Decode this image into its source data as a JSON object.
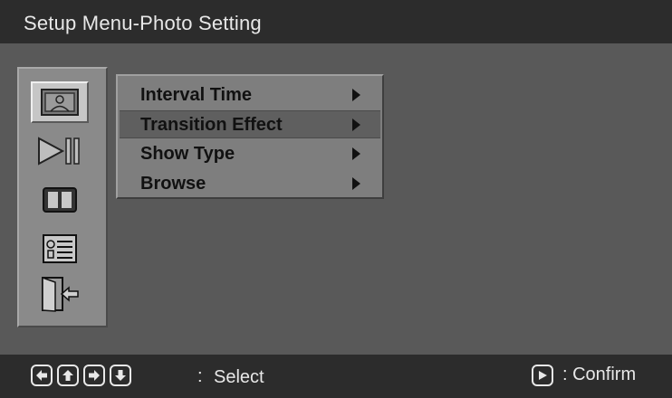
{
  "window": {
    "title": "Setup Menu-Photo Setting"
  },
  "sidebar": {
    "icons": [
      {
        "name": "photo-icon",
        "selected": true
      },
      {
        "name": "play-pause-icon",
        "selected": false
      },
      {
        "name": "display-icon",
        "selected": false
      },
      {
        "name": "info-card-icon",
        "selected": false
      },
      {
        "name": "exit-door-icon",
        "selected": false
      }
    ]
  },
  "menu": {
    "items": [
      {
        "label": "Interval Time",
        "highlighted": false
      },
      {
        "label": "Transition Effect",
        "highlighted": true
      },
      {
        "label": "Show Type",
        "highlighted": false
      },
      {
        "label": "Browse",
        "highlighted": false
      }
    ]
  },
  "footer": {
    "nav_keys": [
      "left-arrow-icon",
      "up-arrow-icon",
      "right-arrow-icon",
      "down-arrow-icon"
    ],
    "separator": ":",
    "select_label": "Select",
    "confirm_label": ": Confirm",
    "confirm_key": "play-icon"
  },
  "colors": {
    "header": "#2c2c2c",
    "background": "#595959",
    "highlight": "#5f5f5f",
    "text_light": "#e8e8e8"
  }
}
